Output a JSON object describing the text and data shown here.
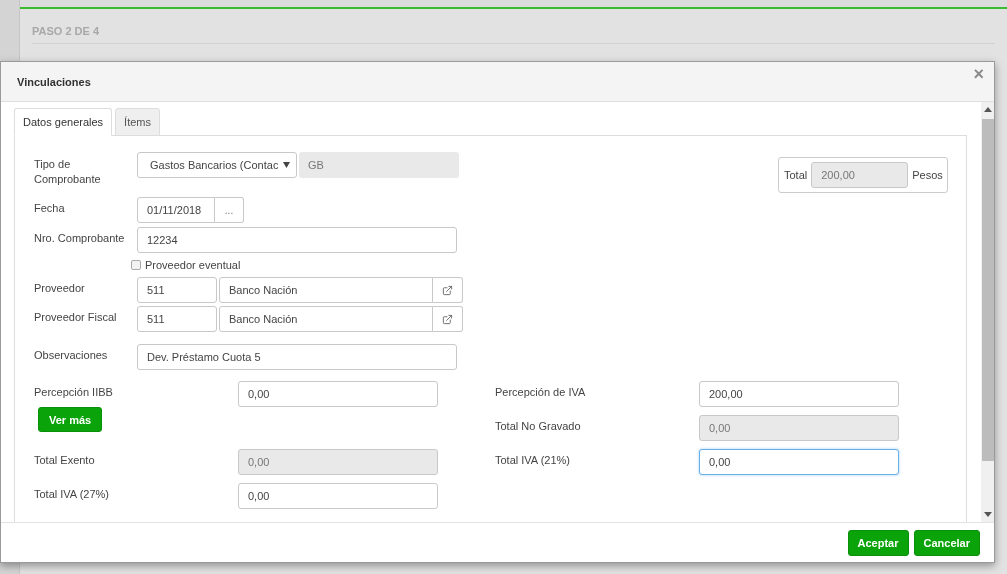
{
  "page": {
    "step_title": "PASO 2 DE 4"
  },
  "modal": {
    "title": "Vinculaciones",
    "close": "×",
    "tabs": [
      {
        "label": "Datos generales",
        "selected": true
      },
      {
        "label": "Ítems",
        "selected": false
      }
    ],
    "tipo_comprobante": {
      "label": "Tipo de Comprobante",
      "value": "Gastos Bancarios (Contac",
      "code": "GB"
    },
    "total": {
      "label": "Total",
      "value": "200,00",
      "currency": "Pesos"
    },
    "fecha": {
      "label": "Fecha",
      "value": "01/11/2018",
      "button": "..."
    },
    "nro_comprobante": {
      "label": "Nro. Comprobante",
      "value": "12234"
    },
    "proveedor_eventual": {
      "label": "Proveedor eventual",
      "checked": false
    },
    "proveedores": [
      {
        "label": "Proveedor",
        "code": "511",
        "name": "Banco Nación"
      },
      {
        "label": "Proveedor Fiscal",
        "code": "511",
        "name": "Banco Nación"
      }
    ],
    "observaciones": {
      "label": "Observaciones",
      "value": "Dev. Préstamo Cuota 5"
    },
    "left_amounts": [
      {
        "kind": "field",
        "label": "Percepción IIBB",
        "value": "0,00",
        "disabled": false,
        "focused": false
      },
      {
        "kind": "button",
        "label": "Ver más"
      },
      {
        "kind": "field",
        "label": "Total Exento",
        "value": "0,00",
        "disabled": true,
        "focused": false
      },
      {
        "kind": "field",
        "label": "Total IVA (27%)",
        "value": "0,00",
        "disabled": false,
        "focused": false
      }
    ],
    "right_amounts": [
      {
        "kind": "field",
        "label": "Percepción de IVA",
        "value": "200,00",
        "disabled": false,
        "focused": false
      },
      {
        "kind": "field",
        "label": "Total No Gravado",
        "value": "0,00",
        "disabled": true,
        "focused": false
      },
      {
        "kind": "field",
        "label": "Total IVA (21%)",
        "value": "0,00",
        "disabled": false,
        "focused": true
      }
    ],
    "buttons": [
      "Aceptar",
      "Cancelar"
    ]
  }
}
